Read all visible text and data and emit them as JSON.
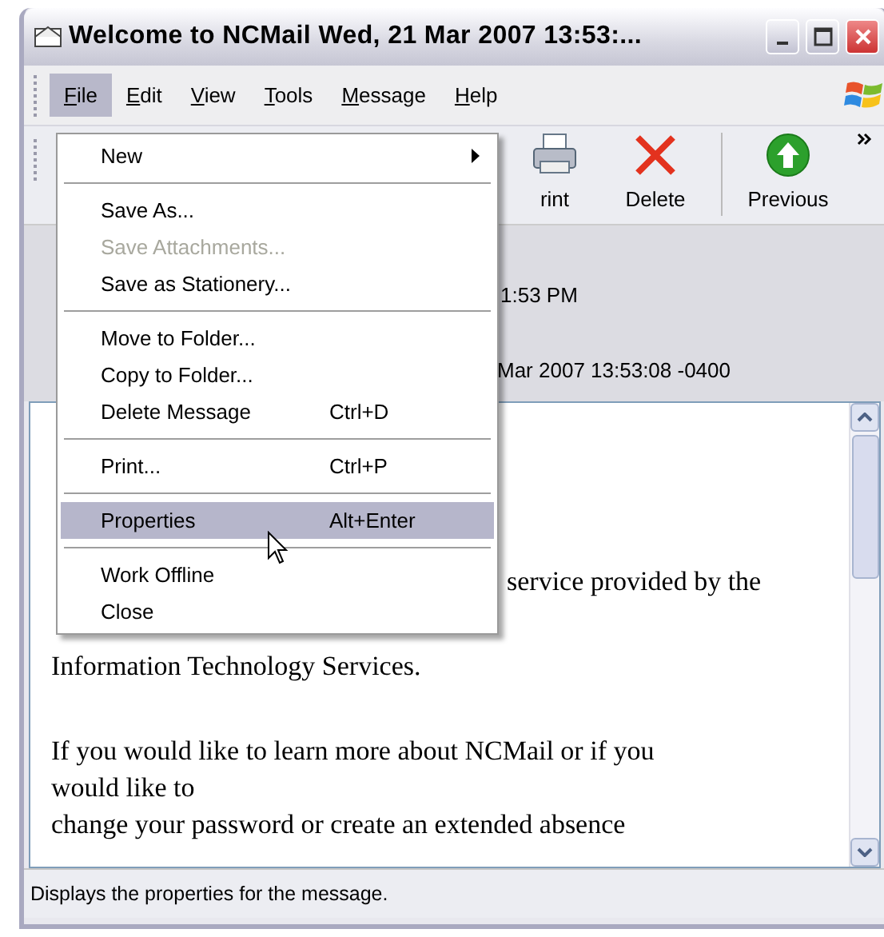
{
  "window": {
    "title": "Welcome to NCMail Wed, 21 Mar 2007 13:53:..."
  },
  "menu_bar": [
    {
      "label": "File",
      "selected": true
    },
    {
      "label": "Edit",
      "selected": false
    },
    {
      "label": "View",
      "selected": false
    },
    {
      "label": "Tools",
      "selected": false
    },
    {
      "label": "Message",
      "selected": false
    },
    {
      "label": "Help",
      "selected": false
    }
  ],
  "toolbar": [
    {
      "label": "rint",
      "kind": "print"
    },
    {
      "label": "Delete",
      "kind": "delete"
    },
    {
      "label": "Previous",
      "kind": "previous"
    }
  ],
  "header_fields": [
    "1:53 PM",
    "Mar 2007 13:53:08 -0400"
  ],
  "body_lines": [
    {
      "text": "service provided by the",
      "kind": "partial"
    },
    {
      "text": "Information Technology Services.",
      "kind": "line"
    },
    {
      "kind": "gap"
    },
    {
      "text": "If you would like to learn more about NCMail or if you",
      "kind": "line"
    },
    {
      "text": "would like to",
      "kind": "line"
    },
    {
      "text": "change your password or create an extended absence",
      "kind": "line"
    }
  ],
  "file_menu": [
    {
      "kind": "item",
      "label": "New",
      "submenu": true,
      "disabled": false,
      "selected": false
    },
    {
      "kind": "separator"
    },
    {
      "kind": "item",
      "label": "Save As...",
      "disabled": false,
      "selected": false
    },
    {
      "kind": "item",
      "label": "Save Attachments...",
      "disabled": true,
      "selected": false
    },
    {
      "kind": "item",
      "label": "Save as Stationery...",
      "disabled": false,
      "selected": false
    },
    {
      "kind": "separator"
    },
    {
      "kind": "item",
      "label": "Move to Folder...",
      "disabled": false,
      "selected": false
    },
    {
      "kind": "item",
      "label": "Copy to Folder...",
      "disabled": false,
      "selected": false
    },
    {
      "kind": "item",
      "label": "Delete Message",
      "shortcut": "Ctrl+D",
      "disabled": false,
      "selected": false
    },
    {
      "kind": "separator"
    },
    {
      "kind": "item",
      "label": "Print...",
      "shortcut": "Ctrl+P",
      "disabled": false,
      "selected": false
    },
    {
      "kind": "separator"
    },
    {
      "kind": "item",
      "label": "Properties",
      "shortcut": "Alt+Enter",
      "disabled": false,
      "selected": true
    },
    {
      "kind": "separator"
    },
    {
      "kind": "item",
      "label": "Work Offline",
      "disabled": false,
      "selected": false
    },
    {
      "kind": "item",
      "label": "Close",
      "disabled": false,
      "selected": false
    }
  ],
  "status_bar": "Displays the properties for the message."
}
